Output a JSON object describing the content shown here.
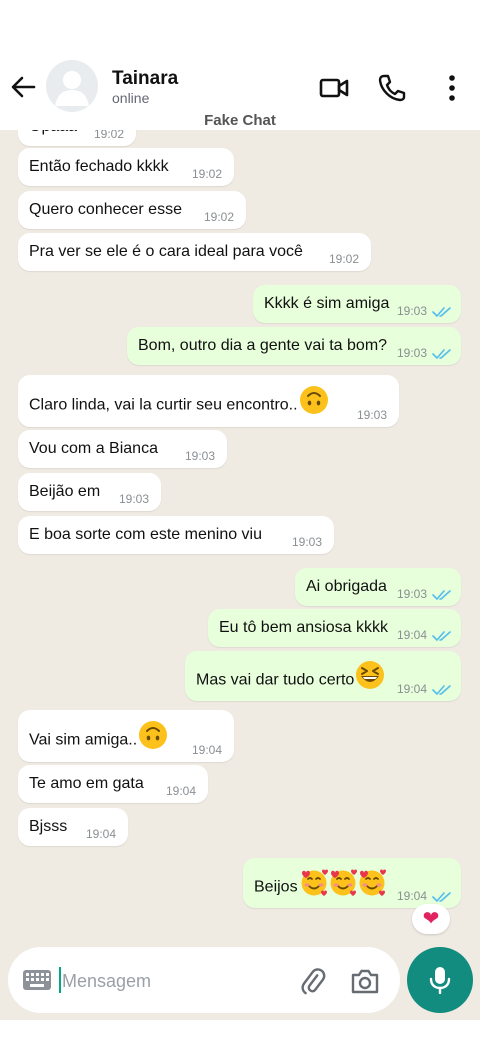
{
  "header": {
    "contact_name": "Tainara",
    "status": "online",
    "watermark": "Fake Chat"
  },
  "messages": [
    {
      "dir": "in",
      "text": "Opaaa",
      "time": "19:02",
      "emoji": []
    },
    {
      "dir": "in",
      "text": "Então fechado kkkk",
      "time": "19:02",
      "emoji": []
    },
    {
      "dir": "in",
      "text": "Quero conhecer esse",
      "time": "19:02",
      "emoji": []
    },
    {
      "dir": "in",
      "text": "Pra ver se ele é o cara ideal para você",
      "time": "19:02",
      "emoji": []
    },
    {
      "dir": "out",
      "text": "Kkkk é sim amiga",
      "time": "19:03",
      "emoji": []
    },
    {
      "dir": "out",
      "text": "Bom, outro dia a gente vai ta bom?",
      "time": "19:03",
      "emoji": []
    },
    {
      "dir": "in",
      "text": "Claro linda, vai la curtir seu encontro..",
      "time": "19:03",
      "emoji": [
        "upside-down-face"
      ]
    },
    {
      "dir": "in",
      "text": "Vou com a Bianca",
      "time": "19:03",
      "emoji": []
    },
    {
      "dir": "in",
      "text": "Beijão em",
      "time": "19:03",
      "emoji": []
    },
    {
      "dir": "in",
      "text": "E boa sorte com este menino viu",
      "time": "19:03",
      "emoji": []
    },
    {
      "dir": "out",
      "text": "Ai obrigada",
      "time": "19:03",
      "emoji": []
    },
    {
      "dir": "out",
      "text": "Eu tô bem ansiosa kkkk",
      "time": "19:04",
      "emoji": []
    },
    {
      "dir": "out",
      "text": "Mas vai dar tudo certo",
      "time": "19:04",
      "emoji": [
        "grinning-squinting-face"
      ]
    },
    {
      "dir": "in",
      "text": "Vai sim amiga..",
      "time": "19:04",
      "emoji": [
        "upside-down-face"
      ]
    },
    {
      "dir": "in",
      "text": "Te amo em gata",
      "time": "19:04",
      "emoji": []
    },
    {
      "dir": "in",
      "text": "Bjsss",
      "time": "19:04",
      "emoji": []
    },
    {
      "dir": "out",
      "text": "Beijos",
      "time": "19:04",
      "emoji": [
        "smiling-face-with-hearts",
        "smiling-face-with-hearts",
        "smiling-face-with-hearts"
      ]
    }
  ],
  "reaction": {
    "icon": "red-heart-icon",
    "color": "#e0245e"
  },
  "composer": {
    "placeholder": "Mensagem",
    "icons": [
      "keyboard-icon",
      "paperclip-icon",
      "camera-icon",
      "microphone-icon"
    ]
  },
  "colors": {
    "chat_background": "#efeae2",
    "incoming_bubble": "#ffffff",
    "outgoing_bubble": "#e7ffdb",
    "read_ticks": "#53bdeb",
    "accent": "#128c7e"
  }
}
